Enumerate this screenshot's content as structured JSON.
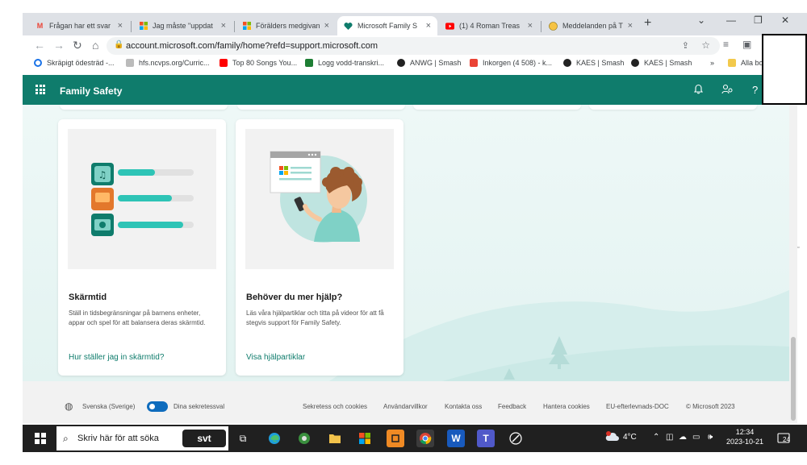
{
  "browser": {
    "tabs": [
      {
        "label": "Frågan har ett svar",
        "icon": "gmail-icon",
        "active": false
      },
      {
        "label": "Jag måste \"uppdat",
        "icon": "microsoft-icon",
        "active": false
      },
      {
        "label": "Förälders medgivan",
        "icon": "microsoft-icon",
        "active": false
      },
      {
        "label": "Microsoft Family S",
        "icon": "family-safety-icon",
        "active": true
      },
      {
        "label": "(1) 4 Roman Treas",
        "icon": "youtube-icon",
        "active": false
      },
      {
        "label": "Meddelanden på T",
        "icon": "smiley-icon",
        "active": false
      }
    ],
    "address": "account.microsoft.com/family/home?refd=support.microsoft.com",
    "bookmarks": [
      {
        "label": "Skräpigt ödesträd -...",
        "color": "#1a73e8"
      },
      {
        "label": "hfs.ncvps.org/Curric...",
        "color": "#888888"
      },
      {
        "label": "Top 80 Songs You...",
        "color": "#ff0000"
      },
      {
        "label": "Logg vodd-transkri...",
        "color": "#1e7e34"
      },
      {
        "label": "ANWG | Smash",
        "color": "#222222"
      },
      {
        "label": "Inkorgen (4 508) - k...",
        "color": "#ea4335"
      },
      {
        "label": "KAES | Smash",
        "color": "#222222"
      },
      {
        "label": "KAES | Smash",
        "color": "#222222"
      },
      {
        "label": "Alla bo",
        "color": "#f2c94c"
      }
    ],
    "more_bookmarks": "»"
  },
  "app": {
    "title": "Family Safety",
    "accent": "#0f7c6c"
  },
  "cards": [
    {
      "title": "Skärmtid",
      "description": "Ställ in tidsbegränsningar på barnens enheter, appar och spel för att balansera deras skärmtid.",
      "link": "Hur ställer jag in skärmtid?"
    },
    {
      "title": "Behöver du mer hjälp?",
      "description": "Läs våra hjälpartiklar och titta på videor för att få stegvis support för Family Safety.",
      "link": "Visa hjälpartiklar"
    }
  ],
  "footer": {
    "language": "Svenska (Sverige)",
    "privacy_choices": "Dina sekretessval",
    "links": [
      "Sekretess och cookies",
      "Användarvillkor",
      "Kontakta oss",
      "Feedback",
      "Hantera cookies",
      "EU-efterlevnads-DOC",
      "© Microsoft 2023"
    ]
  },
  "taskbar": {
    "search_placeholder": "Skriv här för att söka",
    "search_badge": "svt",
    "weather": "4°C",
    "weather_badge": "1",
    "time": "12:34",
    "date": "2023-10-21",
    "notifications": "24"
  }
}
